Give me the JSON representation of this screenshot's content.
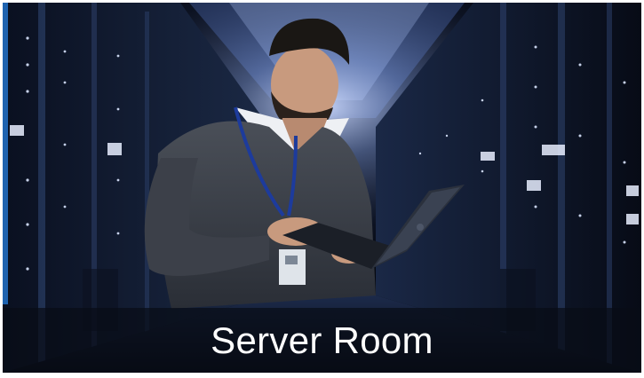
{
  "tile": {
    "caption": "Server Room",
    "image_subject": "technician-with-laptop-in-server-room",
    "colors": {
      "background": "#05070d",
      "rack_light": "#dbe6ff",
      "caption_text": "#ffffff"
    }
  }
}
